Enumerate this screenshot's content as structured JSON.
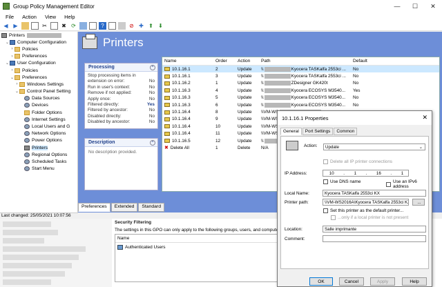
{
  "window": {
    "title": "Group Policy Management Editor",
    "controls": [
      "—",
      "☐",
      "✕"
    ]
  },
  "menu": [
    "File",
    "Action",
    "View",
    "Help"
  ],
  "tree": {
    "root": "Printers",
    "items": [
      {
        "label": "Computer Configuration",
        "indent": 1,
        "exp": "⌄",
        "icon": "book"
      },
      {
        "label": "Policies",
        "indent": 2,
        "exp": "›",
        "icon": "folder"
      },
      {
        "label": "Preferences",
        "indent": 2,
        "exp": "›",
        "icon": "folder"
      },
      {
        "label": "User Configuration",
        "indent": 1,
        "exp": "⌄",
        "icon": "book"
      },
      {
        "label": "Policies",
        "indent": 2,
        "exp": "›",
        "icon": "folder"
      },
      {
        "label": "Preferences",
        "indent": 2,
        "exp": "⌄",
        "icon": "folder"
      },
      {
        "label": "Windows Settings",
        "indent": 3,
        "exp": "›",
        "icon": "folder"
      },
      {
        "label": "Control Panel Setting",
        "indent": 3,
        "exp": "⌄",
        "icon": "folder"
      },
      {
        "label": "Data Sources",
        "indent": 4,
        "exp": "",
        "icon": "gear"
      },
      {
        "label": "Devices",
        "indent": 4,
        "exp": "",
        "icon": "gear"
      },
      {
        "label": "Folder Options",
        "indent": 4,
        "exp": "",
        "icon": "folder"
      },
      {
        "label": "Internet Settings",
        "indent": 4,
        "exp": "",
        "icon": "gear"
      },
      {
        "label": "Local Users and G",
        "indent": 4,
        "exp": "",
        "icon": "gear"
      },
      {
        "label": "Network Options",
        "indent": 4,
        "exp": "",
        "icon": "gear"
      },
      {
        "label": "Power Options",
        "indent": 4,
        "exp": "",
        "icon": "gear"
      },
      {
        "label": "Printers",
        "indent": 4,
        "exp": "",
        "icon": "printer",
        "selected": true
      },
      {
        "label": "Regional Options",
        "indent": 4,
        "exp": "",
        "icon": "gear"
      },
      {
        "label": "Scheduled Tasks",
        "indent": 4,
        "exp": "",
        "icon": "gear"
      },
      {
        "label": "Start Menu",
        "indent": 4,
        "exp": "",
        "icon": "gear"
      }
    ]
  },
  "main": {
    "title": "Printers",
    "processing": {
      "heading": "Processing",
      "rows": [
        {
          "label": "Stop processing items in",
          "value": ""
        },
        {
          "label": "extension on error:",
          "value": "No"
        },
        {
          "label": "Run in user's context:",
          "value": "No"
        },
        {
          "label": "Remove if not applied:",
          "value": "No"
        },
        {
          "label": "Apply once:",
          "value": "No"
        },
        {
          "label": "Filtered directly:",
          "value": "Yes",
          "hl": true
        },
        {
          "label": "Filtered by ancestor:",
          "value": "No"
        },
        {
          "label": "Disabled directly:",
          "value": "No"
        },
        {
          "label": "Disabled by ancestor:",
          "value": "No"
        }
      ]
    },
    "description": {
      "heading": "Description",
      "text": "No description provided."
    },
    "columns": [
      "Name",
      "Order",
      "Action",
      "Path",
      "Default"
    ],
    "rows": [
      {
        "name": "10.1.16.1",
        "order": "2",
        "action": "Update",
        "path_prefix": "\\\\",
        "path_suffix": "Kyocera TASKalfa 2553ci ...",
        "default": "No",
        "selected": true
      },
      {
        "name": "10.1.16.1",
        "order": "3",
        "action": "Update",
        "path_prefix": "\\\\",
        "path_suffix": "Kyocera TASKalfa 2553ci ...",
        "default": "No"
      },
      {
        "name": "10.1.16.2",
        "order": "1",
        "action": "Update",
        "path_prefix": "\\\\",
        "path_suffix": "ZDesigner GK420t",
        "default": "No"
      },
      {
        "name": "10.1.16.3",
        "order": "4",
        "action": "Update",
        "path_prefix": "\\\\",
        "path_suffix": "Kyocera ECOSYS M3540...",
        "default": "Yes"
      },
      {
        "name": "10.1.16.3",
        "order": "5",
        "action": "Update",
        "path_prefix": "\\\\",
        "path_suffix": "Kyocera ECOSYS M3540...",
        "default": "No"
      },
      {
        "name": "10.1.16.3",
        "order": "6",
        "action": "Update",
        "path_prefix": "\\\\",
        "path_suffix": "Kyocera ECOSYS M3540...",
        "default": "No"
      },
      {
        "name": "10.1.16.4",
        "order": "8",
        "action": "Update",
        "path_prefix": "\\\\VM-WS",
        "path_suffix": "",
        "default": ""
      },
      {
        "name": "10.1.16.4",
        "order": "9",
        "action": "Update",
        "path_prefix": "\\\\VM-WS",
        "path_suffix": "",
        "default": ""
      },
      {
        "name": "10.1.16.4",
        "order": "10",
        "action": "Update",
        "path_prefix": "\\\\VM-WS",
        "path_suffix": "",
        "default": ""
      },
      {
        "name": "10.1.16.4",
        "order": "11",
        "action": "Update",
        "path_prefix": "\\\\VM-WS",
        "path_suffix": "",
        "default": ""
      },
      {
        "name": "10.1.16.5",
        "order": "12",
        "action": "Update",
        "path_prefix": "\\\\",
        "path_suffix": "",
        "default": ""
      },
      {
        "name": "Delete All",
        "order": "1",
        "action": "Delete",
        "path_prefix": "N/A",
        "path_suffix": "",
        "default": "",
        "delete": true
      }
    ],
    "tabs": [
      "Preferences",
      "Extended",
      "Standard"
    ]
  },
  "status": "Last changed: 25/05/2021 10:07:56",
  "bottom": {
    "section": "Security Filtering",
    "note": "The settings in this GPO can only apply to the following groups, users, and computers:",
    "col": "Name",
    "entry": "Authenticated Users"
  },
  "dialog": {
    "title": "10.1.16.1 Properties",
    "close": "✕",
    "tabs": [
      "General",
      "Port Settings",
      "Common"
    ],
    "action_label": "Action:",
    "action_value": "Update",
    "delete_all": "Delete all IP printer connections",
    "ip_label": "IP Address:",
    "ip": [
      "10",
      "1",
      "16",
      "1"
    ],
    "use_dns": "Use DNS name",
    "use_ipv6": "Use an IPv6 address",
    "local_name_label": "Local Name:",
    "local_name": "Kyocera TASKalfa 2553ci KX",
    "path_label": "Printer path:",
    "path_value": "\\\\VM-WS2016A\\Kyocera TASKalfa 2553ci KX",
    "browse": "...",
    "set_default": "Set this printer as the default printer...",
    "only_if": "...only if a local printer is not present",
    "location_label": "Location:",
    "location": "Salle imprimante",
    "comment_label": "Comment:",
    "comment": "",
    "buttons": [
      "OK",
      "Cancel",
      "Apply",
      "Help"
    ]
  },
  "colors": {
    "accent": "#6d8ed8",
    "selection": "#cce8ff",
    "heading": "#1f3f8a"
  }
}
